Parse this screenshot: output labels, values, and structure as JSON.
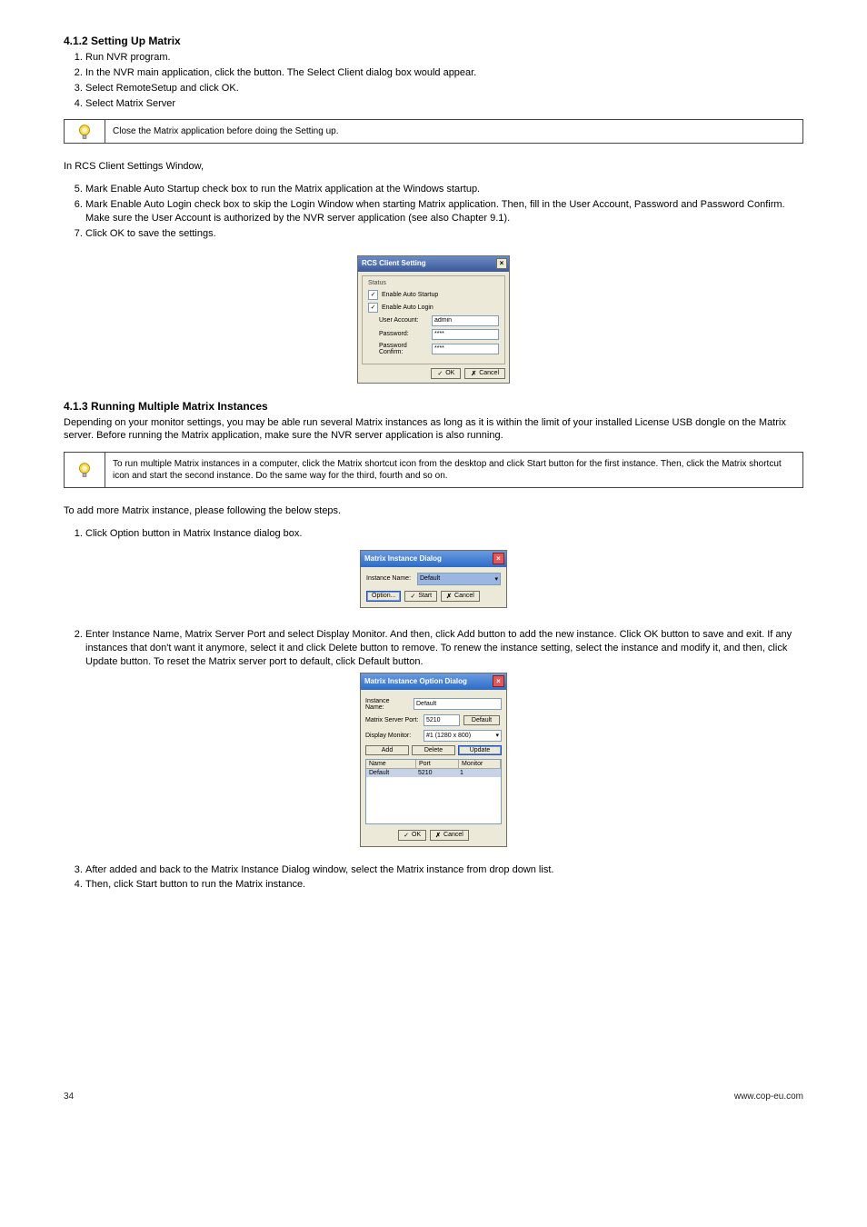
{
  "section1": {
    "heading": "4.1.2  Setting Up Matrix",
    "list": [
      "Run NVR program.",
      "In the NVR main application, click the     button. The Select Client dialog box would appear.",
      "Select RemoteSetup and click OK.",
      "Select Matrix Server"
    ],
    "tip": "Close the Matrix application before doing the Setting up.",
    "afterTipIntro": "In RCS Client Settings Window,",
    "settingsList": [
      "Mark Enable Auto Startup check box to run the Matrix application at the Windows startup.",
      "Mark Enable Auto Login check box to skip the Login Window when starting Matrix application. Then, fill in the User Account, Password and Password Confirm. Make sure the User Account is authorized by the NVR server application (see also Chapter 9.1).",
      "Click OK to save the settings."
    ]
  },
  "dlg1": {
    "title": "RCS Client Setting",
    "group": "Status",
    "chk1": "Enable Auto Startup",
    "chk2": "Enable Auto Login",
    "userLbl": "User Account:",
    "userVal": "admin",
    "pwLbl": "Password:",
    "pwVal": "****",
    "pwcLbl": "Password Confirm:",
    "pwcVal": "****",
    "ok": "OK",
    "cancel": "Cancel"
  },
  "section2": {
    "heading": "4.1.3  Running Multiple Matrix Instances",
    "intro": "Depending on your monitor settings, you may be able run several Matrix instances as long as it is within the limit of your installed License USB dongle on the Matrix server. Before running the Matrix application, make sure the NVR server application is also running.",
    "tip": "To run multiple Matrix instances in a computer, click the Matrix     shortcut icon from the desktop and click Start button for the first instance. Then, click the Matrix shortcut icon and start the second instance. Do the same way for the third, fourth and so on.",
    "steps1": [
      "Click Option button in Matrix Instance dialog box."
    ],
    "steps2": [
      "Enter Instance Name, Matrix Server Port and select Display Monitor. And then, click Add button to add the new instance. Click OK button to save and exit. If any instances that don't want it anymore, select it and click Delete button to remove. To renew the instance setting, select the instance and modify it, and then, click Update button. To reset the Matrix server port to default, click Default button.",
      "After added and back to the Matrix Instance Dialog window, select the Matrix instance from drop down list.",
      "Then, click Start button to run the Matrix instance."
    ],
    "steps2Intro": "To add more Matrix instance, please following the below steps."
  },
  "dlg2": {
    "title": "Matrix Instance Dialog",
    "nameLbl": "Instance Name:",
    "nameVal": "Default",
    "option": "Option...",
    "start": "Start",
    "cancel": "Cancel"
  },
  "dlg3": {
    "title": "Matrix Instance Option Dialog",
    "nameLbl": "Instance Name:",
    "nameVal": "Default",
    "portLbl": "Matrix Server Port:",
    "portVal": "5210",
    "defaultBtn": "Default",
    "monLbl": "Display Monitor:",
    "monVal": "#1 (1280 x 800)",
    "add": "Add",
    "delete": "Delete",
    "update": "Update",
    "thName": "Name",
    "thPort": "Port",
    "thMon": "Monitor",
    "row": {
      "name": "Default",
      "port": "5210",
      "mon": "1"
    },
    "ok": "OK",
    "cancel": "Cancel"
  },
  "footer": {
    "left": "34",
    "right": "www.cop-eu.com"
  },
  "glyphs": {
    "check": "✓",
    "x": "✗",
    "close": "×",
    "chev": "▾"
  }
}
